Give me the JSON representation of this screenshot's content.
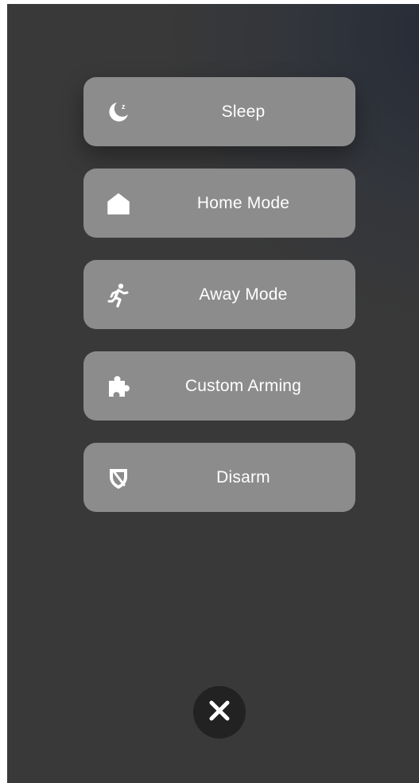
{
  "menu": {
    "items": [
      {
        "label": "Sleep",
        "icon": "moon-sleep-icon"
      },
      {
        "label": "Home Mode",
        "icon": "home-icon"
      },
      {
        "label": "Away Mode",
        "icon": "running-person-icon"
      },
      {
        "label": "Custom Arming",
        "icon": "puzzle-icon"
      },
      {
        "label": "Disarm",
        "icon": "shield-off-icon"
      }
    ]
  },
  "close_button": {
    "icon": "close-icon"
  },
  "colors": {
    "background": "#393939",
    "button": "#8c8c8c",
    "close_button": "#222222",
    "text": "#ffffff"
  }
}
